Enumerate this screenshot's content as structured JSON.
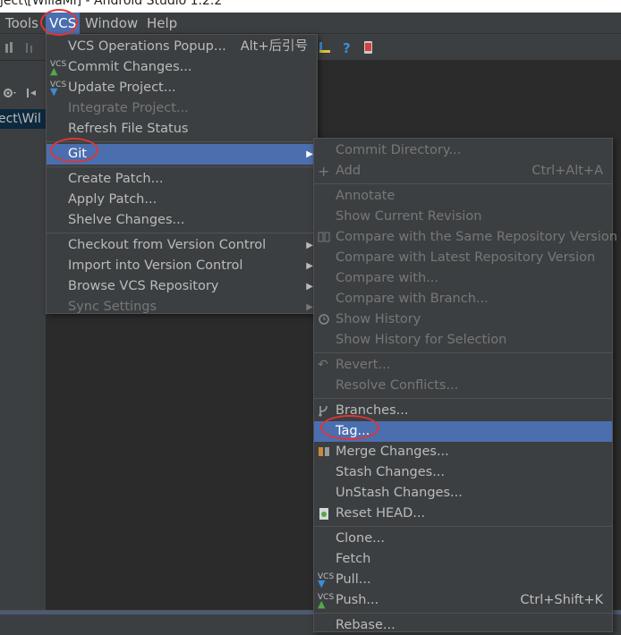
{
  "title_strip": "ject\\[WillaMl] - Android Studio 1.2.2",
  "menubar": {
    "tools": "Tools",
    "vcs": "VCS",
    "window": "Window",
    "help": "Help"
  },
  "left_panel": {
    "path_text": "ect\\Wil"
  },
  "vcs_menu": {
    "operations_popup": "VCS Operations Popup...",
    "operations_shortcut": "Alt+后引号",
    "commit_changes": "Commit Changes...",
    "update_project": "Update Project...",
    "integrate_project": "Integrate Project...",
    "refresh_file_status": "Refresh File Status",
    "git": "Git",
    "create_patch": "Create Patch...",
    "apply_patch": "Apply Patch...",
    "shelve_changes": "Shelve Changes...",
    "checkout": "Checkout from Version Control",
    "import": "Import into Version Control",
    "browse": "Browse VCS Repository",
    "sync_settings": "Sync Settings"
  },
  "git_menu": {
    "commit_directory": "Commit Directory...",
    "add": "Add",
    "add_shortcut": "Ctrl+Alt+A",
    "annotate": "Annotate",
    "show_current_revision": "Show Current Revision",
    "compare_same_repo": "Compare with the Same Repository Version",
    "compare_latest": "Compare with Latest Repository Version",
    "compare_with": "Compare with...",
    "compare_branch": "Compare with Branch...",
    "show_history": "Show History",
    "show_history_selection": "Show History for Selection",
    "revert": "Revert...",
    "resolve_conflicts": "Resolve Conflicts...",
    "branches": "Branches...",
    "tag": "Tag...",
    "merge_changes": "Merge Changes...",
    "stash_changes": "Stash Changes...",
    "unstash_changes": "UnStash Changes...",
    "reset_head": "Reset HEAD...",
    "clone": "Clone...",
    "fetch": "Fetch",
    "pull": "Pull...",
    "push": "Push...",
    "push_shortcut": "Ctrl+Shift+K",
    "rebase": "Rebase..."
  },
  "icon_label": "VCS",
  "colors": {
    "menu_bg": "#3c3f41",
    "selection": "#4b6eaf",
    "highlight_ring": "#e03535"
  }
}
